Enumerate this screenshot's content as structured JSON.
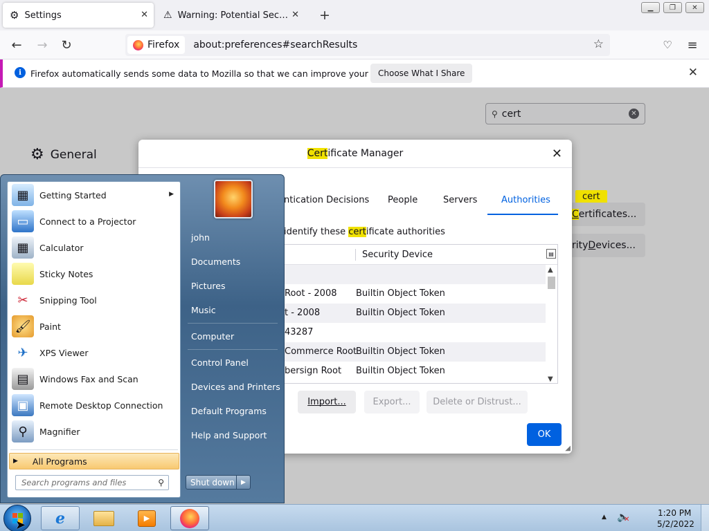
{
  "browser": {
    "tabs": [
      {
        "title": "Settings",
        "active": true,
        "icon": "gear-icon"
      },
      {
        "title": "Warning: Potential Security Risk",
        "active": false,
        "icon": "warning-icon"
      }
    ],
    "identity_label": "Firefox",
    "url": "about:preferences#searchResults"
  },
  "notification": {
    "text": "Firefox automatically sends some data to Mozilla so that we can improve your experience.",
    "button": "Choose What I Share"
  },
  "preferences": {
    "search_value": "cert",
    "category": "General",
    "tooltip": "cert",
    "btn_view_certs_hl": "C",
    "btn_view_certs_rest": "ertificates...",
    "btn_devices_prefix": "rity ",
    "btn_devices_underline": "D",
    "btn_devices_rest": "evices..."
  },
  "cert_manager": {
    "title_hl": "Cert",
    "title_rest": "ificate Manager",
    "tabs": [
      "ntication Decisions",
      "People",
      "Servers",
      "Authorities"
    ],
    "active_tab": "Authorities",
    "desc_pre": "identify these ",
    "desc_hl": "cert",
    "desc_post": "ificate authorities",
    "columns": {
      "device": "Security Device"
    },
    "rows": [
      {
        "name": "",
        "device": ""
      },
      {
        "name": "Root - 2008",
        "device": "Builtin Object Token"
      },
      {
        "name": "t - 2008",
        "device": "Builtin Object Token"
      },
      {
        "name": "43287",
        "device": ""
      },
      {
        "name": " Commerce Root",
        "device": "Builtin Object Token"
      },
      {
        "name": "bersign Root",
        "device": "Builtin Object Token"
      }
    ],
    "buttons": {
      "import": "Import...",
      "export": "Export...",
      "delete": "Delete or Distrust...",
      "ok": "OK"
    }
  },
  "start_menu": {
    "programs": [
      {
        "label": "Getting Started",
        "icon": "getting-started-icon",
        "submenu": true
      },
      {
        "label": "Connect to a Projector",
        "icon": "projector-icon"
      },
      {
        "label": "Calculator",
        "icon": "calculator-icon"
      },
      {
        "label": "Sticky Notes",
        "icon": "sticky-notes-icon"
      },
      {
        "label": "Snipping Tool",
        "icon": "snipping-tool-icon"
      },
      {
        "label": "Paint",
        "icon": "paint-icon"
      },
      {
        "label": "XPS Viewer",
        "icon": "xps-viewer-icon"
      },
      {
        "label": "Windows Fax and Scan",
        "icon": "fax-scan-icon"
      },
      {
        "label": "Remote Desktop Connection",
        "icon": "remote-desktop-icon"
      },
      {
        "label": "Magnifier",
        "icon": "magnifier-icon"
      }
    ],
    "all_programs": "All Programs",
    "search_placeholder": "Search programs and files",
    "right_links": [
      "john",
      "Documents",
      "Pictures",
      "Music",
      "Computer",
      "Control Panel",
      "Devices and Printers",
      "Default Programs",
      "Help and Support"
    ],
    "shutdown": "Shut down"
  },
  "taskbar": {
    "time": "1:20 PM",
    "date": "5/2/2022",
    "apps": [
      "internet-explorer-icon",
      "file-explorer-icon",
      "media-player-icon",
      "firefox-icon"
    ]
  },
  "colors": {
    "accent_blue": "#0061e0",
    "search_highlight": "#f0e100",
    "notification_border": "#c51ab4"
  }
}
